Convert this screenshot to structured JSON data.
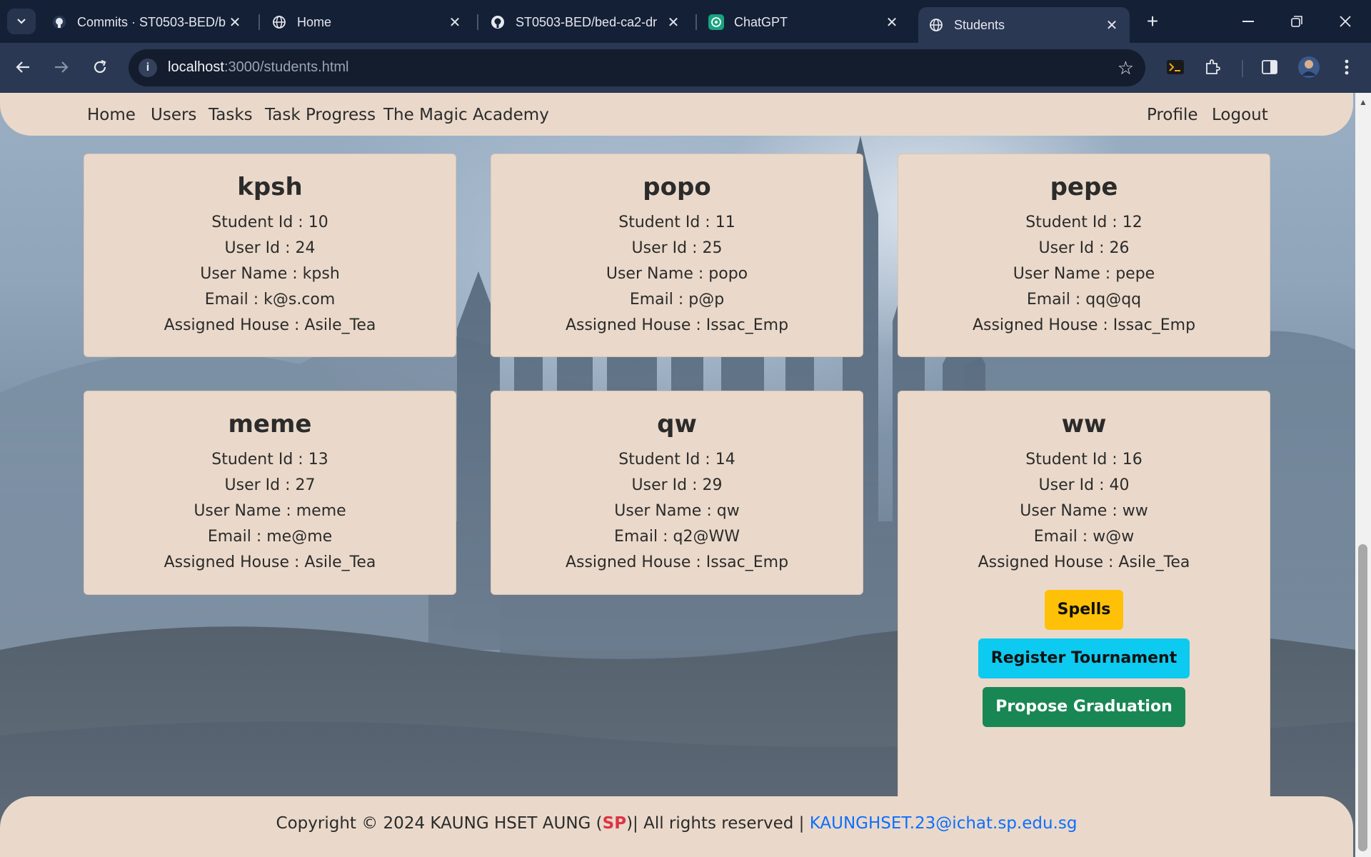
{
  "browser": {
    "tabs": [
      {
        "label": "Commits · ST0503-BED/b",
        "icon": "github-icon",
        "active": false
      },
      {
        "label": "Home",
        "icon": "globe-icon",
        "active": false
      },
      {
        "label": "ST0503-BED/bed-ca2-dr",
        "icon": "github-icon",
        "active": false
      },
      {
        "label": "ChatGPT",
        "icon": "chatgpt-icon",
        "active": false
      },
      {
        "label": "Students",
        "icon": "globe-icon",
        "active": true
      }
    ],
    "url_host": "localhost",
    "url_rest": ":3000/students.html"
  },
  "nav": {
    "left": [
      "Home",
      "Users",
      "Tasks",
      "Task Progress",
      "The Magic Academy"
    ],
    "right": [
      "Profile",
      "Logout"
    ]
  },
  "students": [
    {
      "name": "kpsh",
      "student_id": "Student Id : 10",
      "user_id": "User Id : 24",
      "username": "User Name : kpsh",
      "email": "Email : k@s.com",
      "house": "Assigned House : Asile_Tea"
    },
    {
      "name": "popo",
      "student_id": "Student Id : 11",
      "user_id": "User Id : 25",
      "username": "User Name : popo",
      "email": "Email : p@p",
      "house": "Assigned House : Issac_Emp"
    },
    {
      "name": "pepe",
      "student_id": "Student Id : 12",
      "user_id": "User Id : 26",
      "username": "User Name : pepe",
      "email": "Email : qq@qq",
      "house": "Assigned House : Issac_Emp"
    },
    {
      "name": "meme",
      "student_id": "Student Id : 13",
      "user_id": "User Id : 27",
      "username": "User Name : meme",
      "email": "Email : me@me",
      "house": "Assigned House : Asile_Tea"
    },
    {
      "name": "qw",
      "student_id": "Student Id : 14",
      "user_id": "User Id : 29",
      "username": "User Name : qw",
      "email": "Email : q2@WW",
      "house": "Assigned House : Issac_Emp"
    },
    {
      "name": "ww",
      "student_id": "Student Id : 16",
      "user_id": "User Id : 40",
      "username": "User Name : ww",
      "email": "Email : w@w",
      "house": "Assigned House : Asile_Tea"
    }
  ],
  "actions": {
    "spells": "Spells",
    "register": "Register Tournament",
    "graduate": "Propose Graduation"
  },
  "footer": {
    "prefix": "Copyright © 2024 KAUNG HSET AUNG (",
    "sp": "SP",
    "suffix": ")| All rights reserved | ",
    "email": "KAUNGHSET.23@ichat.sp.edu.sg"
  },
  "colors": {
    "card_bg": "#ead9ca",
    "spells": "#ffc107",
    "register": "#0dcaf0",
    "graduate": "#198754",
    "chrome_bg": "#142036"
  }
}
